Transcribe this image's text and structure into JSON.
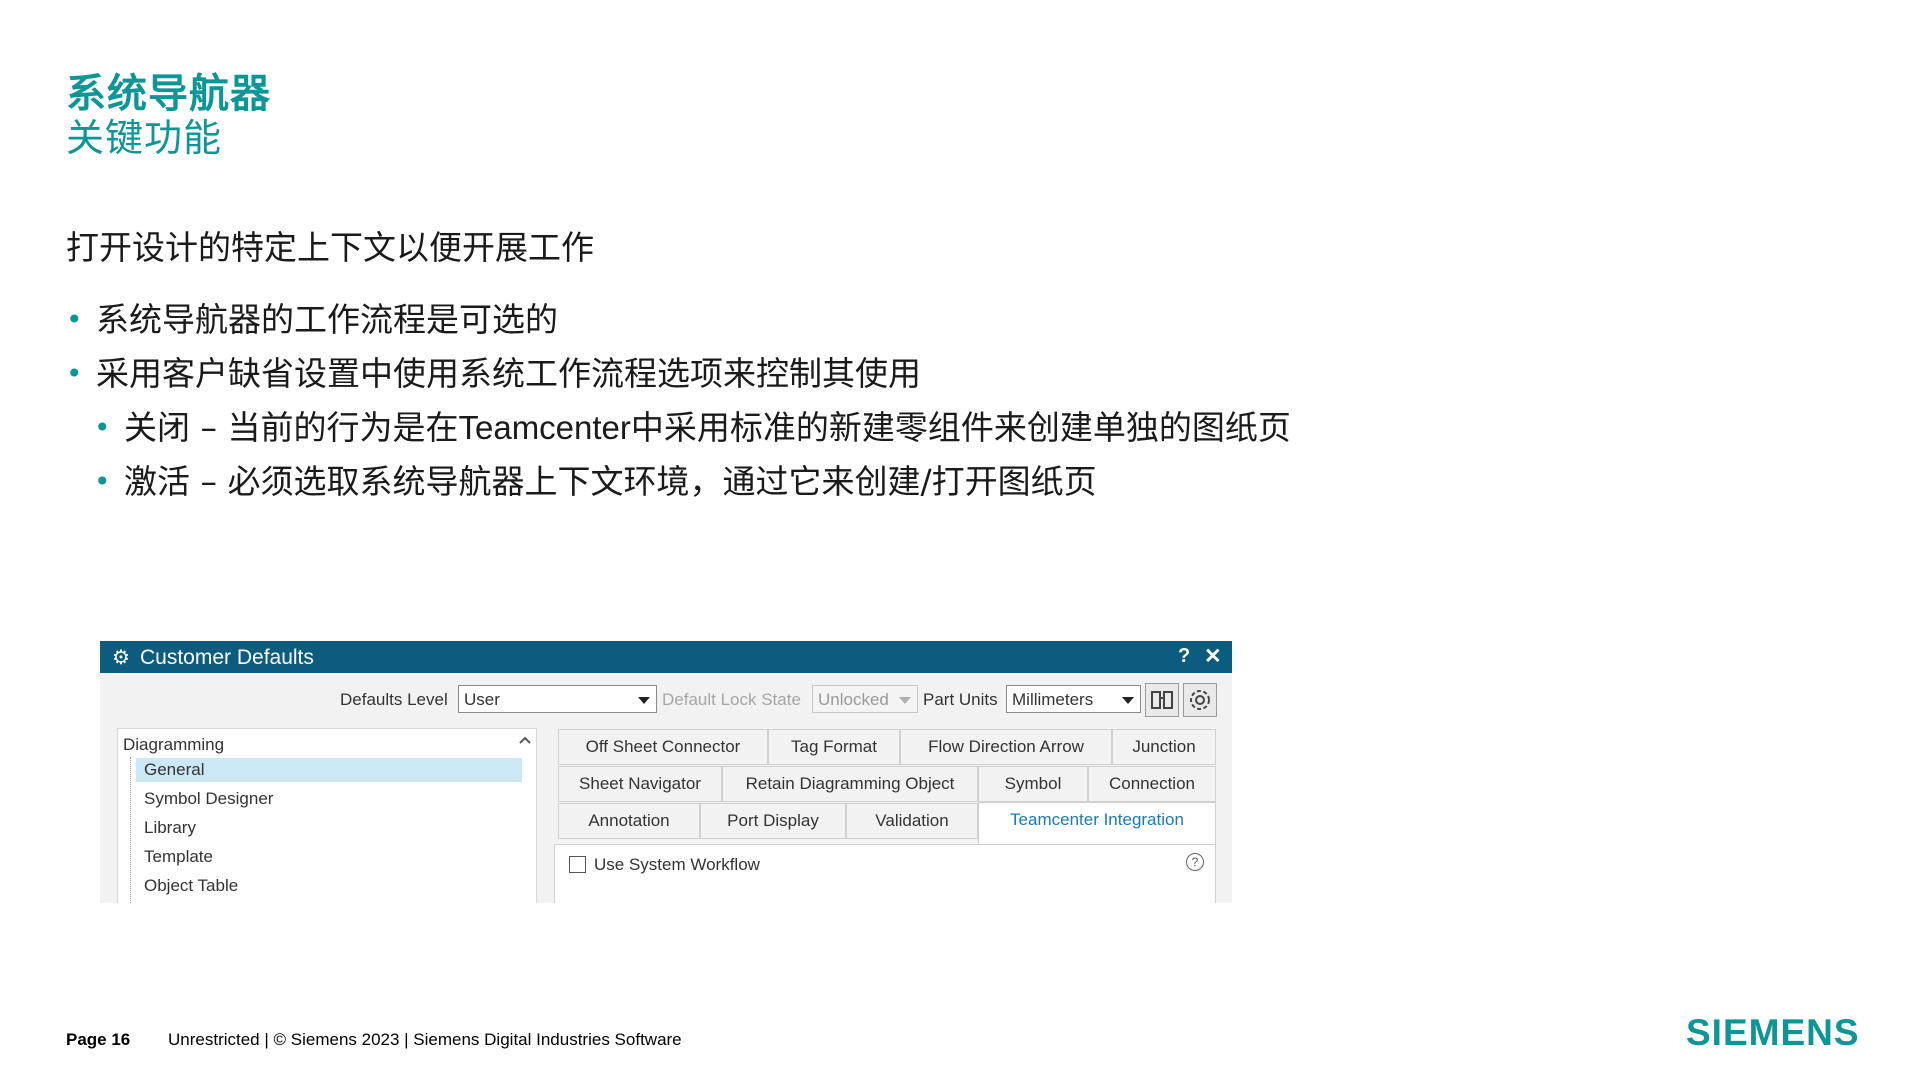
{
  "slide": {
    "title": "系统导航器",
    "subtitle": "关键功能",
    "intro": "打开设计的特定上下文以便开展工作",
    "bullets": [
      "系统导航器的工作流程是可选的",
      "采用客户缺省设置中使用系统工作流程选项来控制其使用"
    ],
    "sub_bullets": [
      {
        "prefix": "关闭 – 当前的行为是在",
        "brand": "Teamcenter",
        "suffix": "中采用标准的新建零组件来创建单独的图纸页"
      },
      {
        "prefix": "激活 – 必须选取系统导航器上下文环境，通过它来创建/打开图纸页",
        "brand": "",
        "suffix": ""
      }
    ],
    "bullet_glyph": "•"
  },
  "dialog": {
    "title": "Customer Defaults",
    "icons": {
      "title": "gear-icon",
      "help": "help-icon",
      "close": "close-icon",
      "find": "binoculars-icon",
      "settings": "gear-icon"
    },
    "help_glyph": "?",
    "close_glyph": "✕",
    "toolbar": {
      "defaults_level_label": "Defaults Level",
      "defaults_level_value": "User",
      "lock_state_label": "Default Lock State",
      "lock_state_value": "Unlocked",
      "part_units_label": "Part Units",
      "part_units_value": "Millimeters"
    },
    "tree": {
      "root": "Diagramming",
      "items": [
        "General",
        "Symbol Designer",
        "Library",
        "Template",
        "Object Table"
      ],
      "selected": "General"
    },
    "tabs": {
      "row1": [
        "Off Sheet Connector",
        "Tag Format",
        "Flow Direction Arrow",
        "Junction"
      ],
      "row2": [
        "Sheet Navigator",
        "Retain Diagramming Object",
        "Symbol",
        "Connection"
      ],
      "row3": [
        "Annotation",
        "Port Display",
        "Validation",
        "Teamcenter Integration"
      ],
      "active": "Teamcenter Integration"
    },
    "option_label": "Use System Workflow",
    "option_checked": false,
    "colors": {
      "titlebar": "#0c5c80",
      "accent": "#0e9596",
      "selection": "#cce8f4",
      "active_tab_text": "#1b7ab8"
    }
  },
  "footer": {
    "page": "Page 16",
    "text": "Unrestricted | © Siemens 2023 | Siemens Digital Industries Software",
    "logo": "SIEMENS"
  }
}
